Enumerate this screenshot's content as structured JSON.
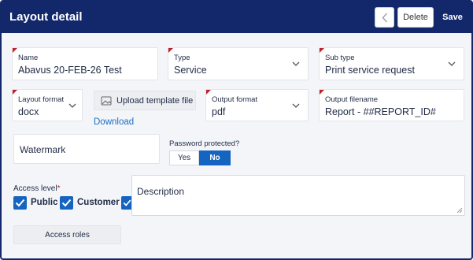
{
  "header": {
    "title": "Layout detail",
    "delete_label": "Delete",
    "save_label": "Save"
  },
  "fields": {
    "name": {
      "label": "Name",
      "value": "Abavus 20-FEB-26 Test"
    },
    "type": {
      "label": "Type",
      "value": "Service"
    },
    "sub_type": {
      "label": "Sub type",
      "value": "Print service request"
    },
    "layout_format": {
      "label": "Layout format",
      "value": "docx"
    },
    "output_format": {
      "label": "Output format",
      "value": "pdf"
    },
    "output_filename": {
      "label": "Output filename",
      "value": "Report - ##REPORT_ID#"
    }
  },
  "upload": {
    "label": "Upload template file",
    "download_label": "Download"
  },
  "watermark": {
    "placeholder": "Watermark"
  },
  "password": {
    "label": "Password protected?",
    "yes": "Yes",
    "no": "No",
    "selected": "No"
  },
  "access": {
    "label": "Access level",
    "required_marker": "*",
    "options": [
      {
        "label": "Public",
        "checked": true
      },
      {
        "label": "Customer",
        "checked": true
      }
    ],
    "roles_button": "Access roles"
  },
  "description": {
    "placeholder": "Description"
  },
  "colors": {
    "header_bg": "#13286b",
    "accent": "#1565c0",
    "required": "#c0202a",
    "link": "#1a6fc4"
  },
  "icons": {
    "back": "chevron-left-icon",
    "upload": "image-upload-icon",
    "dropdown": "chevron-down-icon",
    "checkbox": "checkmark-icon",
    "resize": "resize-handle-icon"
  }
}
